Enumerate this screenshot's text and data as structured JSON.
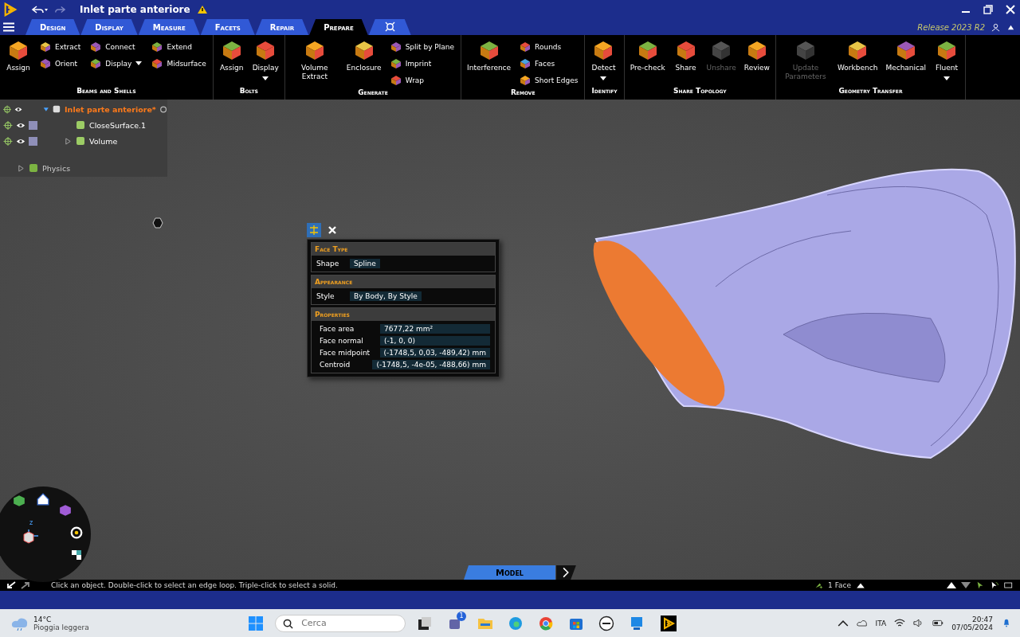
{
  "window": {
    "title": "Inlet parte anteriore",
    "release": "Release 2023 R2"
  },
  "tabs": [
    {
      "kind": "text",
      "label": "Design",
      "selected": false
    },
    {
      "kind": "text",
      "label": "Display",
      "selected": false
    },
    {
      "kind": "text",
      "label": "Measure",
      "selected": false
    },
    {
      "kind": "text",
      "label": "Facets",
      "selected": false
    },
    {
      "kind": "text",
      "label": "Repair",
      "selected": false
    },
    {
      "kind": "text",
      "label": "Prepare",
      "selected": true
    },
    {
      "kind": "icon",
      "selected": false
    }
  ],
  "ribbon": [
    {
      "label": "Beams and Shells",
      "items": [
        {
          "kind": "large",
          "label": "Assign",
          "disabled": false
        },
        {
          "kind": "stack",
          "tools": [
            {
              "label": "Extract"
            },
            {
              "label": "Orient"
            }
          ]
        },
        {
          "kind": "stack",
          "tools": [
            {
              "label": "Connect"
            },
            {
              "label": "Display",
              "dropdown": true
            }
          ]
        },
        {
          "kind": "stack",
          "tools": [
            {
              "label": "Extend"
            },
            {
              "label": "Midsurface"
            }
          ]
        }
      ]
    },
    {
      "label": "Bolts",
      "items": [
        {
          "kind": "large",
          "label": "Assign",
          "disabled": false
        },
        {
          "kind": "large",
          "label": "Display",
          "disabled": false,
          "dropdown": true
        }
      ]
    },
    {
      "label": "Generate",
      "items": [
        {
          "kind": "large",
          "label": "Volume Extract",
          "disabled": false
        },
        {
          "kind": "large",
          "label": "Enclosure",
          "disabled": false
        },
        {
          "kind": "stack",
          "tools": [
            {
              "label": "Split by Plane"
            },
            {
              "label": "Imprint"
            },
            {
              "label": "Wrap"
            }
          ]
        }
      ]
    },
    {
      "label": "Remove",
      "items": [
        {
          "kind": "large",
          "label": "Interference",
          "disabled": false
        },
        {
          "kind": "stack",
          "tools": [
            {
              "label": "Rounds"
            },
            {
              "label": "Faces"
            },
            {
              "label": "Short Edges"
            }
          ]
        }
      ]
    },
    {
      "label": "Identify",
      "items": [
        {
          "kind": "large",
          "label": "Detect",
          "disabled": false,
          "dropdown": true
        }
      ]
    },
    {
      "label": "Share Topology",
      "items": [
        {
          "kind": "large",
          "label": "Pre-check",
          "disabled": false
        },
        {
          "kind": "large",
          "label": "Share",
          "disabled": false
        },
        {
          "kind": "large",
          "label": "Unshare",
          "disabled": true
        },
        {
          "kind": "large",
          "label": "Review",
          "disabled": false
        }
      ]
    },
    {
      "label": "Geometry Transfer",
      "items": [
        {
          "kind": "large",
          "label": "Update Parameters",
          "disabled": true
        },
        {
          "kind": "large",
          "label": "Workbench",
          "disabled": false
        },
        {
          "kind": "large",
          "label": "Mechanical",
          "disabled": false
        },
        {
          "kind": "large",
          "label": "Fluent",
          "disabled": false,
          "dropdown": true
        }
      ]
    }
  ],
  "tree": [
    {
      "kind": "document",
      "label": "Inlet parte anteriore*",
      "expanded": true,
      "children": [
        {
          "kind": "body",
          "label": "CloseSurface.1"
        },
        {
          "kind": "body",
          "label": "Volume",
          "expanded": false
        }
      ]
    },
    {
      "kind": "section",
      "label": "Physics",
      "expanded": false
    }
  ],
  "face_info": {
    "sections": [
      {
        "title": "Face Type",
        "rows": [
          {
            "label": "Shape",
            "value": "Spline"
          }
        ]
      },
      {
        "title": "Appearance",
        "rows": [
          {
            "label": "Style",
            "value": "By Body, By Style"
          }
        ]
      },
      {
        "title": "Properties",
        "rows": [
          {
            "label": "Face area",
            "value": "7677,22 mm²"
          },
          {
            "label": "Face normal",
            "value": "(-1, 0, 0)"
          },
          {
            "label": "Face midpoint",
            "value": "(-1748,5, 0,03, -489,42) mm"
          },
          {
            "label": "Centroid",
            "value": "(-1748,5, -4e-05, -488,66) mm"
          }
        ]
      }
    ]
  },
  "navigator": {
    "axis_label": "z"
  },
  "view_tab": "Model",
  "status_bar": {
    "hint": "Click an object. Double-click to select an edge loop. Triple-click to select a solid.",
    "selection": "1 Face"
  },
  "taskbar": {
    "temperature": "14°C",
    "weather": "Pioggia leggera",
    "search": {
      "placeholder": "Cerca"
    },
    "badge": "1",
    "language": "ITA",
    "time": "20:47",
    "date": "07/05/2024"
  }
}
